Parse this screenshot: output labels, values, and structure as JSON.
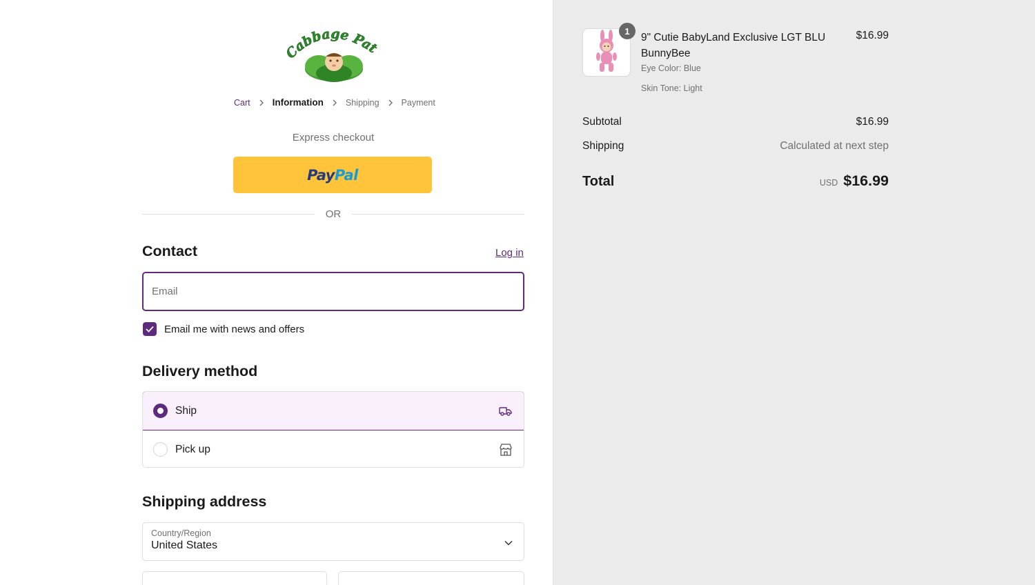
{
  "brand": {
    "logo_text": "Cabbage Patch Kids"
  },
  "breadcrumb": {
    "cart": "Cart",
    "information": "Information",
    "shipping": "Shipping",
    "payment": "Payment"
  },
  "express": {
    "title": "Express checkout",
    "paypal_a": "Pay",
    "paypal_b": "Pal",
    "or": "OR"
  },
  "contact": {
    "heading": "Contact",
    "login": "Log in",
    "email_placeholder": "Email",
    "news_label": "Email me with news and offers",
    "news_checked": true
  },
  "delivery": {
    "heading": "Delivery method",
    "options": [
      {
        "label": "Ship",
        "icon": "truck-icon",
        "selected": true
      },
      {
        "label": "Pick up",
        "icon": "store-icon",
        "selected": false
      }
    ]
  },
  "shipping_address": {
    "heading": "Shipping address",
    "country_label": "Country/Region",
    "country_value": "United States"
  },
  "summary": {
    "item": {
      "quantity": "1",
      "name": "9\" Cutie BabyLand Exclusive LGT BLU BunnyBee",
      "eye": "Eye Color: Blue",
      "skin": "Skin Tone: Light",
      "price": "$16.99"
    },
    "subtotal_label": "Subtotal",
    "subtotal_value": "$16.99",
    "shipping_label": "Shipping",
    "shipping_value": "Calculated at next step",
    "total_label": "Total",
    "currency": "USD",
    "total_value": "$16.99"
  },
  "colors": {
    "accent": "#5e2a7e",
    "paypal_bg": "#ffc43a",
    "summary_bg": "#ebebeb"
  }
}
